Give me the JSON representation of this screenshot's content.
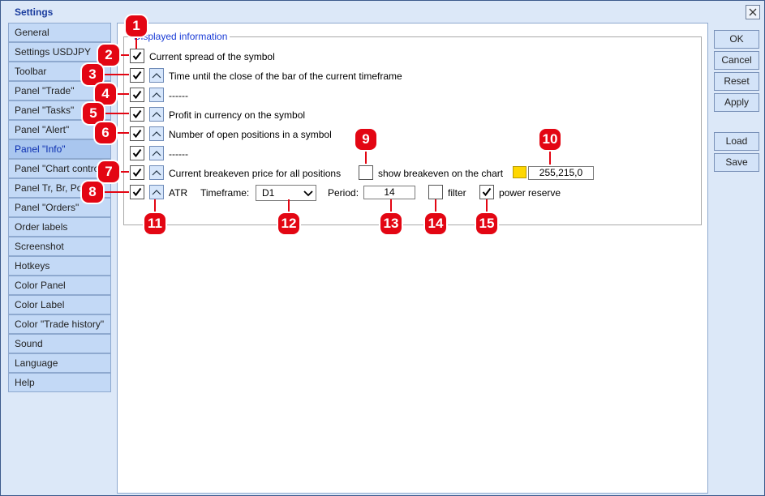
{
  "window": {
    "title": "Settings"
  },
  "sidebar": {
    "items": [
      {
        "label": "General"
      },
      {
        "label": "Settings USDJPY"
      },
      {
        "label": "Toolbar"
      },
      {
        "label": "Panel \"Trade\""
      },
      {
        "label": "Panel \"Tasks\""
      },
      {
        "label": "Panel \"Alert\""
      },
      {
        "label": "Panel \"Info\"",
        "active": true
      },
      {
        "label": "Panel \"Chart control\""
      },
      {
        "label": "Panel Tr, Br, Pos"
      },
      {
        "label": "Panel \"Orders\""
      },
      {
        "label": "Order labels"
      },
      {
        "label": "Screenshot"
      },
      {
        "label": "Hotkeys"
      },
      {
        "label": "Color Panel"
      },
      {
        "label": "Color Label"
      },
      {
        "label": "Color \"Trade history\""
      },
      {
        "label": "Sound"
      },
      {
        "label": "Language"
      },
      {
        "label": "Help"
      }
    ]
  },
  "group": {
    "title": "Displayed information"
  },
  "rows": {
    "spread": {
      "label": "Current spread of the symbol",
      "checked": true
    },
    "bar_close": {
      "label": "Time until the close of the bar of the current timeframe",
      "checked": true
    },
    "sep1": {
      "label": "------",
      "checked": true
    },
    "profit": {
      "label": "Profit in currency on the symbol",
      "checked": true
    },
    "positions": {
      "label": "Number of open positions in a symbol",
      "checked": true
    },
    "sep2": {
      "label": "------",
      "checked": true
    },
    "breakeven": {
      "label": "Current breakeven price for all positions",
      "checked": true,
      "show_label": "show breakeven on the chart",
      "show_checked": false,
      "color_value": "255,215,0",
      "color_hex": "#FFD700"
    },
    "atr": {
      "label": "ATR",
      "checked": true,
      "timeframe_label": "Timeframe:",
      "timeframe_value": "D1",
      "period_label": "Period:",
      "period_value": "14",
      "filter_label": "filter",
      "filter_checked": false,
      "power_label": "power reserve",
      "power_checked": true
    }
  },
  "buttons": {
    "ok": "OK",
    "cancel": "Cancel",
    "reset": "Reset",
    "apply": "Apply",
    "load": "Load",
    "save": "Save"
  },
  "callouts": [
    "1",
    "2",
    "3",
    "4",
    "5",
    "6",
    "7",
    "8",
    "9",
    "10",
    "11",
    "12",
    "13",
    "14",
    "15"
  ],
  "colors": {
    "accent": "#E30613",
    "title": "#1A3C9E",
    "group_title": "#1A3CD6"
  }
}
